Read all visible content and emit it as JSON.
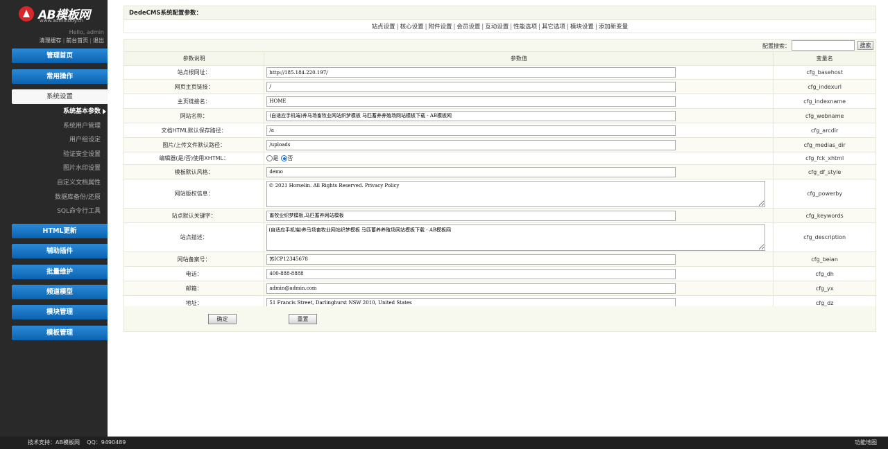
{
  "sidebar": {
    "logo_text": "AB模板网",
    "logo_url": "www.adminbuy.cn",
    "hello": "Hello, admin",
    "links": [
      "清理缓存",
      "前台首页",
      "退出"
    ],
    "nav_top": [
      {
        "label": "管理首页"
      },
      {
        "label": "常用操作"
      },
      {
        "label": "系统设置"
      }
    ],
    "sub_items": [
      {
        "label": "系统基本参数"
      },
      {
        "label": "系统用户管理"
      },
      {
        "label": "用户组设定"
      },
      {
        "label": "验证安全设置"
      },
      {
        "label": "图片水印设置"
      },
      {
        "label": "自定义文档属性"
      },
      {
        "label": "数据库备份/还原"
      },
      {
        "label": "SQL命令行工具"
      }
    ],
    "nav_bottom": [
      {
        "label": "HTML更新"
      },
      {
        "label": "辅助插件"
      },
      {
        "label": "批量维护"
      },
      {
        "label": "频道模型"
      },
      {
        "label": "模块管理"
      },
      {
        "label": "模板管理"
      }
    ]
  },
  "header": {
    "title": "DedeCMS系统配置参数：",
    "tabs": [
      "站点设置",
      "核心设置",
      "附件设置",
      "会员设置",
      "互动设置",
      "性能选项",
      "其它选项",
      "模块设置",
      "添加新变量"
    ]
  },
  "search": {
    "label": "配置搜索：",
    "value": "",
    "button": "搜索"
  },
  "table": {
    "headers": [
      "参数说明",
      "参数值",
      "变量名"
    ],
    "rows": [
      {
        "label": "站点根网址：",
        "type": "text",
        "value": "http://185.184.220.197/",
        "var": "cfg_basehost"
      },
      {
        "label": "网页主页链接：",
        "type": "text",
        "value": "/",
        "var": "cfg_indexurl"
      },
      {
        "label": "主页链接名：",
        "type": "text",
        "value": "HOME",
        "var": "cfg_indexname"
      },
      {
        "label": "网站名称：",
        "type": "text",
        "value": "(自适应手机端)养马场畜牧业网站织梦模板 马匹蓄养养殖场网站模板下载 - AB模板网",
        "var": "cfg_webname"
      },
      {
        "label": "文档HTML默认保存路径：",
        "type": "text",
        "value": "/a",
        "var": "cfg_arcdir"
      },
      {
        "label": "图片/上传文件默认路径：",
        "type": "text",
        "value": "/uploads",
        "var": "cfg_medias_dir"
      },
      {
        "label": "编辑器(是/否)使用XHTML：",
        "type": "radio",
        "options": [
          "是",
          "否"
        ],
        "selected": "否",
        "var": "cfg_fck_xhtml"
      },
      {
        "label": "模板默认风格：",
        "type": "text",
        "value": "demo",
        "var": "cfg_df_style"
      },
      {
        "label": "网站版权信息：",
        "type": "textarea",
        "value": "© 2021 Horselin. All Rights Reserved. Privacy Policy",
        "var": "cfg_powerby"
      },
      {
        "label": "站点默认关键字：",
        "type": "text",
        "value": "畜牧业织梦模板,马匹蓄养网站模板",
        "var": "cfg_keywords"
      },
      {
        "label": "站点描述：",
        "type": "textarea",
        "value": "(自适应手机端)养马场畜牧业网站织梦模板 马匹蓄养养殖场网站模板下载 - AB模板网",
        "var": "cfg_description"
      },
      {
        "label": "网站备案号：",
        "type": "text",
        "value": "苏ICP12345678",
        "var": "cfg_beian"
      },
      {
        "label": "电话：",
        "type": "text",
        "value": "400-888-8888",
        "var": "cfg_dh"
      },
      {
        "label": "邮箱：",
        "type": "text",
        "value": "admin@admin.com",
        "var": "cfg_yx"
      },
      {
        "label": "地址：",
        "type": "text",
        "value": "51 Francis Street, Darlinghurst NSW 2010, United States",
        "var": "cfg_dz"
      }
    ]
  },
  "buttons": {
    "submit": "确定",
    "reset": "重置"
  },
  "footer": {
    "support": "技术支持：AB模板网",
    "qq": "QQ：9490489",
    "sitemap": "功能地图"
  }
}
